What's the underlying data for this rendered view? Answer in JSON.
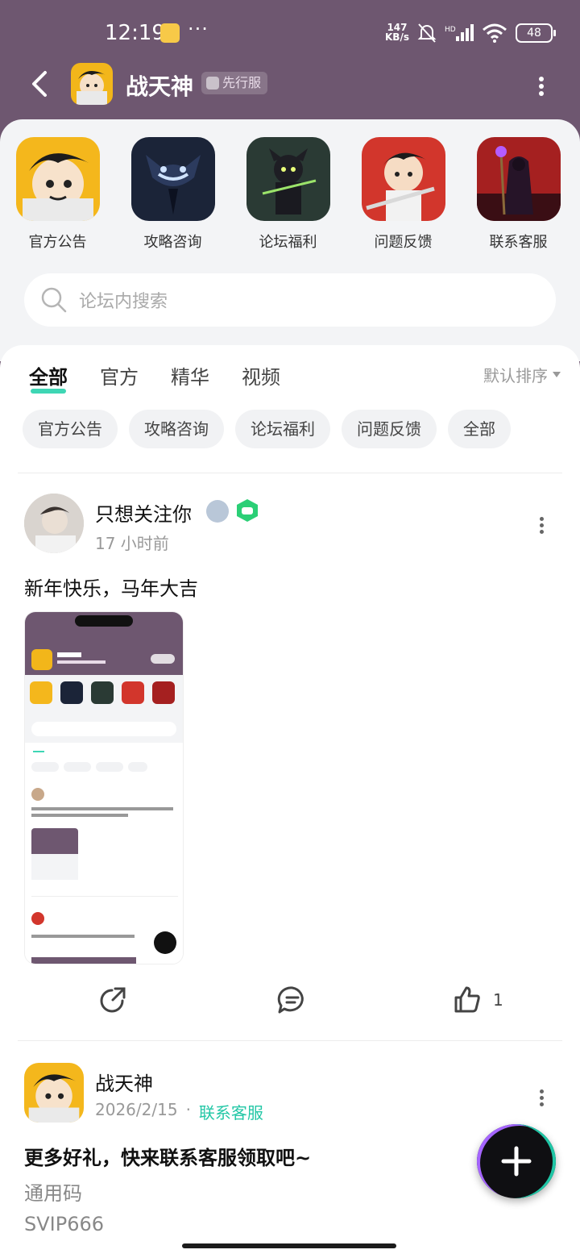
{
  "status_bar": {
    "time": "12:19",
    "more": "···",
    "speed_value": "147",
    "speed_unit": "KB/s",
    "battery": "48"
  },
  "header": {
    "title": "战天神",
    "beta_badge": "先行服"
  },
  "quick_links": [
    {
      "label": "官方公告",
      "icon": "hero-portrait-icon"
    },
    {
      "label": "攻略咨询",
      "icon": "shadow-demon-icon"
    },
    {
      "label": "论坛福利",
      "icon": "ninja-icon"
    },
    {
      "label": "问题反馈",
      "icon": "swordsman-icon"
    },
    {
      "label": "联系客服",
      "icon": "mage-icon"
    }
  ],
  "search": {
    "placeholder": "论坛内搜索"
  },
  "tabs": [
    "全部",
    "官方",
    "精华",
    "视频"
  ],
  "sort": {
    "label": "默认排序"
  },
  "chips": [
    "官方公告",
    "攻略咨询",
    "论坛福利",
    "问题反馈",
    "全部"
  ],
  "post1": {
    "author": "只想关注你",
    "time": "17 小时前",
    "text": "新年快乐，马年大吉",
    "likes": "1"
  },
  "post2": {
    "author": "战天神",
    "date": "2026/2/15",
    "dot": "·",
    "tag": "联系客服",
    "title": "更多好礼，快来联系客服领取吧~",
    "line1": "通用码",
    "line2": "SVIP666"
  },
  "colors": {
    "header_bg": "#6e5770",
    "accent": "#3ed6b4",
    "link": "#23c7a6"
  }
}
